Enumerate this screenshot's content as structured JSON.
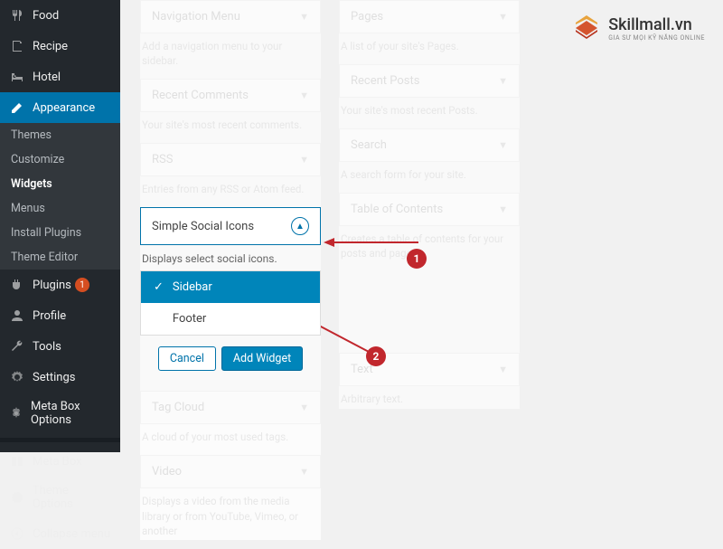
{
  "sidebar": {
    "items": [
      {
        "label": "Food",
        "icon": "food-icon"
      },
      {
        "label": "Recipe",
        "icon": "recipe-icon"
      },
      {
        "label": "Hotel",
        "icon": "hotel-icon"
      }
    ],
    "appearance": {
      "label": "Appearance",
      "sub": [
        {
          "label": "Themes"
        },
        {
          "label": "Customize"
        },
        {
          "label": "Widgets"
        },
        {
          "label": "Menus"
        },
        {
          "label": "Install Plugins"
        },
        {
          "label": "Theme Editor"
        }
      ]
    },
    "items2": [
      {
        "label": "Plugins",
        "icon": "plugin-icon",
        "badge": "1"
      },
      {
        "label": "Profile",
        "icon": "profile-icon"
      },
      {
        "label": "Tools",
        "icon": "tools-icon"
      },
      {
        "label": "Settings",
        "icon": "settings-icon"
      },
      {
        "label": "Meta Box Options",
        "icon": "settings-icon"
      }
    ],
    "items3": [
      {
        "label": "Meta Box",
        "icon": "metabox-icon"
      },
      {
        "label": "Theme Options",
        "icon": "theme-icon"
      }
    ],
    "collapse": "Collapse menu"
  },
  "widgets_left": [
    {
      "title": "Navigation Menu",
      "desc": "Add a navigation menu to your sidebar."
    },
    {
      "title": "Recent Comments",
      "desc": "Your site's most recent comments."
    },
    {
      "title": "RSS",
      "desc": "Entries from any RSS or Atom feed."
    }
  ],
  "widgets_right": [
    {
      "title": "Pages",
      "desc": "A list of your site's Pages."
    },
    {
      "title": "Recent Posts",
      "desc": "Your site's most recent Posts."
    },
    {
      "title": "Search",
      "desc": "A search form for your site."
    },
    {
      "title": "Table of Contents",
      "desc": "Creates a table of contents for your posts and pages."
    },
    {
      "title": "Text",
      "desc": "Arbitrary text."
    }
  ],
  "active_widget": {
    "title": "Simple Social Icons",
    "desc": "Displays select social icons.",
    "areas": [
      {
        "label": "Sidebar",
        "selected": true
      },
      {
        "label": "Footer",
        "selected": false
      }
    ],
    "cancel": "Cancel",
    "add": "Add Widget"
  },
  "widgets_bottom": [
    {
      "title": "Tag Cloud",
      "desc": "A cloud of your most used tags."
    },
    {
      "title": "Video",
      "desc": "Displays a video from the media library or from YouTube, Vimeo, or another"
    }
  ],
  "logo": {
    "text": "Skillmall.vn",
    "sub": "GIA SƯ MỌI KỸ NĂNG ONLINE"
  },
  "annot": {
    "n1": "1",
    "n2": "2"
  }
}
